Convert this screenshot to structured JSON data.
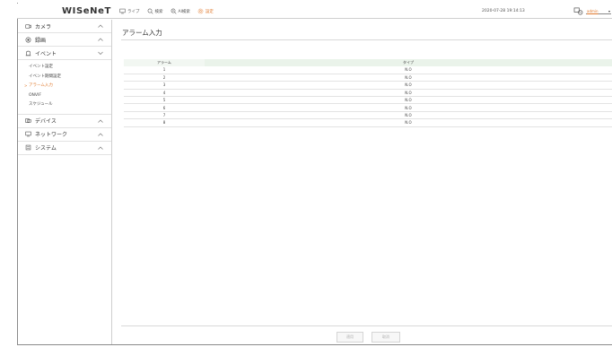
{
  "header": {
    "logo": "WISeNeT",
    "menu": [
      {
        "label": "ライブ",
        "icon": "monitor-icon",
        "active": false
      },
      {
        "label": "検索",
        "icon": "search-icon",
        "active": false
      },
      {
        "label": "AI検索",
        "icon": "ai-search-icon",
        "active": false
      },
      {
        "label": "設定",
        "icon": "gear-icon",
        "active": true
      }
    ],
    "datetime": "2020-07-28 19:14:13",
    "user": "admin",
    "accent_color": "#e07a2e"
  },
  "sidebar": {
    "items": [
      {
        "label": "カメラ",
        "icon": "camera-icon",
        "expanded": false
      },
      {
        "label": "録画",
        "icon": "record-icon",
        "expanded": false
      },
      {
        "label": "イベント",
        "icon": "event-icon",
        "expanded": true,
        "children": [
          {
            "label": "イベント設定",
            "active": false
          },
          {
            "label": "イベント期間設定",
            "active": false
          },
          {
            "label": "アラーム入力",
            "active": true
          },
          {
            "label": "ONVIF",
            "active": false
          },
          {
            "label": "スケジュール",
            "active": false
          }
        ]
      },
      {
        "label": "デバイス",
        "icon": "device-icon",
        "expanded": false
      },
      {
        "label": "ネットワーク",
        "icon": "network-icon",
        "expanded": false
      },
      {
        "label": "システム",
        "icon": "system-icon",
        "expanded": false
      }
    ]
  },
  "main": {
    "title": "アラーム入力",
    "table": {
      "headers": [
        "アラーム",
        "タイプ"
      ],
      "rows": [
        [
          "1",
          "N.O"
        ],
        [
          "2",
          "N.O"
        ],
        [
          "3",
          "N.O"
        ],
        [
          "4",
          "N.O"
        ],
        [
          "5",
          "N.O"
        ],
        [
          "6",
          "N.O"
        ],
        [
          "7",
          "N.O"
        ],
        [
          "8",
          "N.O"
        ]
      ]
    },
    "buttons": {
      "apply": "適用",
      "cancel": "取消"
    }
  }
}
